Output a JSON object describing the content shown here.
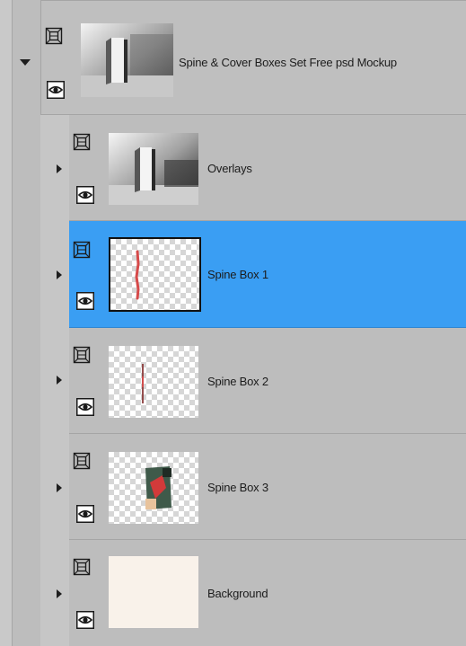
{
  "layers": {
    "group": {
      "name": "Spine & Cover Boxes Set Free psd Mockup",
      "expanded": true
    },
    "children": [
      {
        "name": "Overlays",
        "selected": false,
        "thumbnail": "photo-overlay"
      },
      {
        "name": "Spine Box 1",
        "selected": true,
        "thumbnail": "transparent-red-stroke"
      },
      {
        "name": "Spine Box 2",
        "selected": false,
        "thumbnail": "transparent-thin-line"
      },
      {
        "name": "Spine Box 3",
        "selected": false,
        "thumbnail": "transparent-image"
      },
      {
        "name": "Background",
        "selected": false,
        "thumbnail": "solid-cream"
      }
    ]
  },
  "icons": {
    "expand": "triangle-right-icon",
    "collapse": "triangle-down-icon",
    "lock": "frame-lock-icon",
    "visibility": "eye-icon"
  },
  "colors": {
    "panel": "#bdbdbd",
    "selection": "#3a9ef3",
    "background_swatch": "#f9f2ea",
    "accent_red": "#d64a4a"
  }
}
